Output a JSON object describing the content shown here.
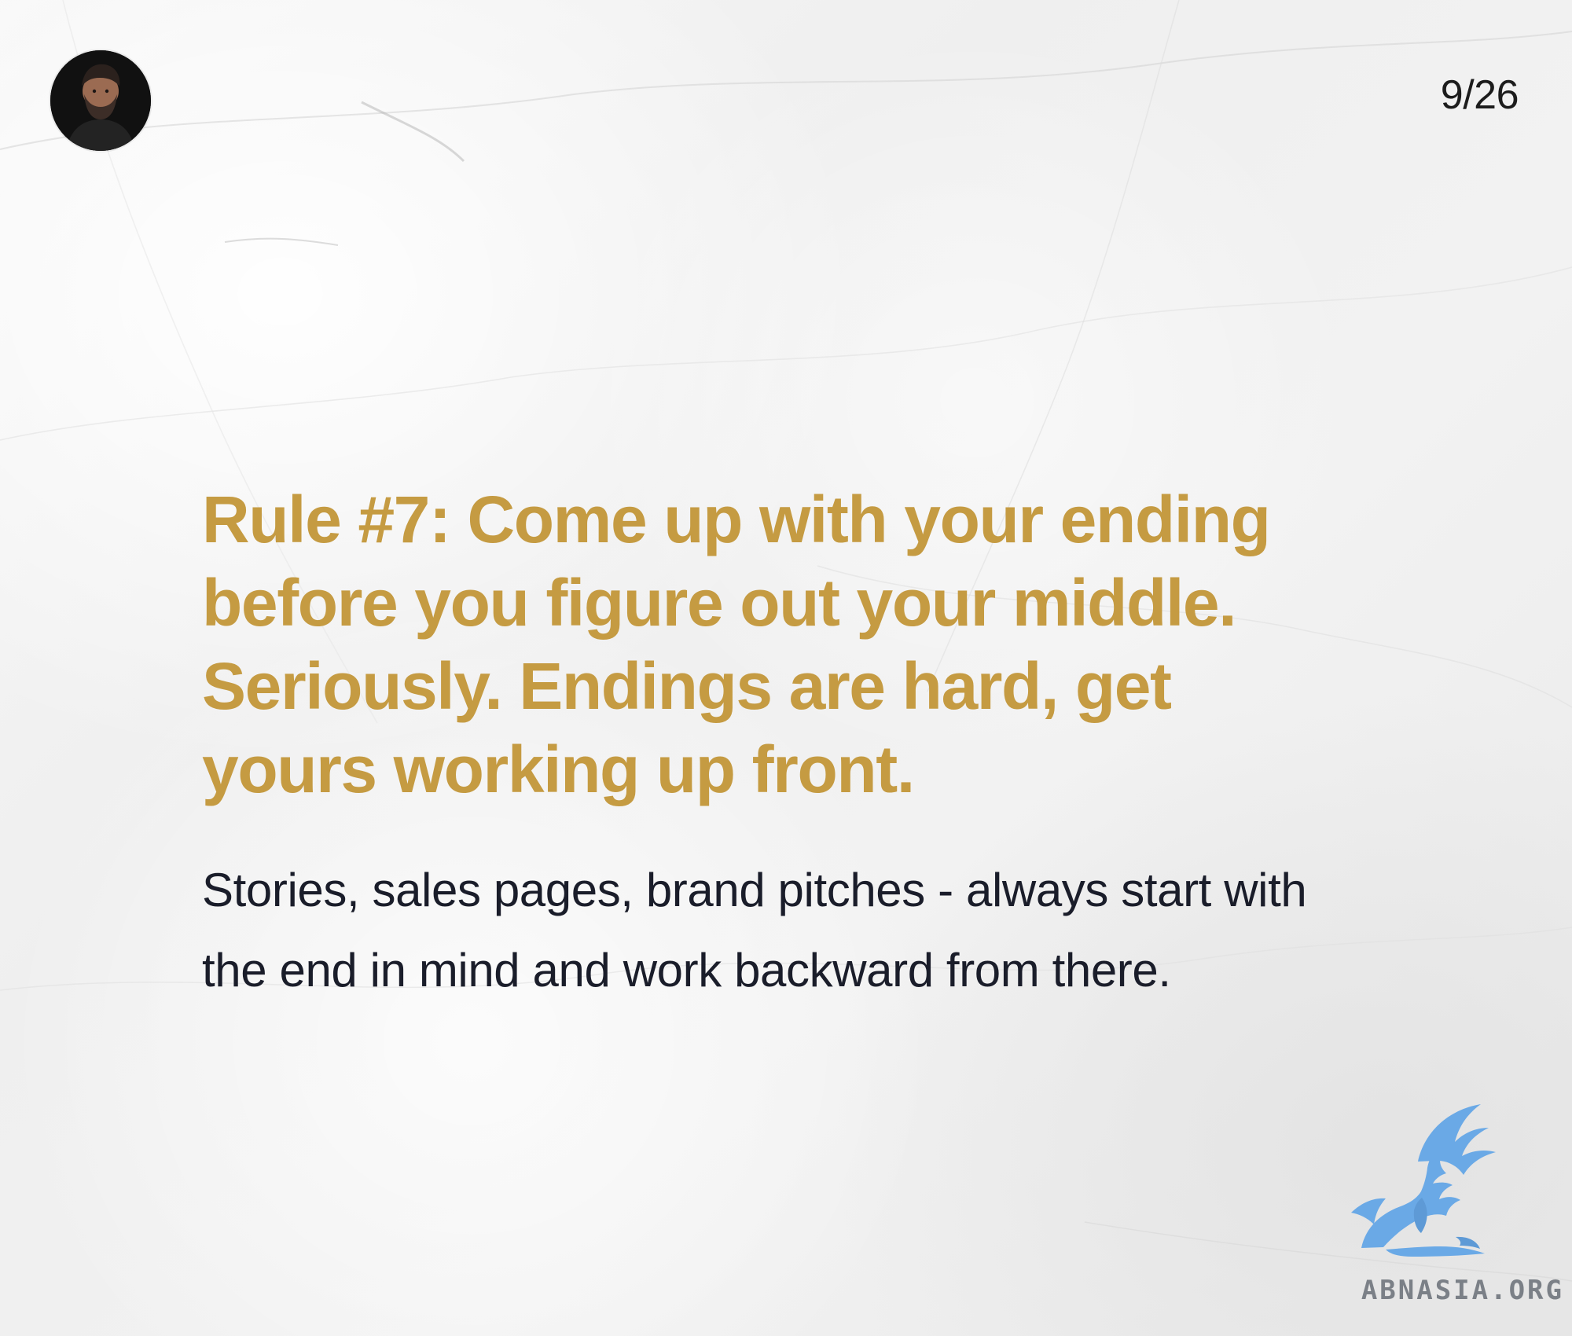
{
  "slide": {
    "counter": "9/26"
  },
  "profile": {
    "avatar": "presenter-avatar"
  },
  "content": {
    "heading": "Rule #7: Come up with your ending before you figure out your middle. Seriously. Endings are hard, get yours working up front.",
    "body": "Stories, sales pages, brand pitches - always start with the end in mind and work backward from there."
  },
  "watermark": {
    "logo_icon": "griffin-logo-icon",
    "text": "ABNASIA.ORG"
  },
  "colors": {
    "heading": "#c59b42",
    "body": "#1a1d2a",
    "counter": "#1c1c1c",
    "watermark_icon": "#6aa9e6",
    "watermark_text": "#7b8087"
  }
}
